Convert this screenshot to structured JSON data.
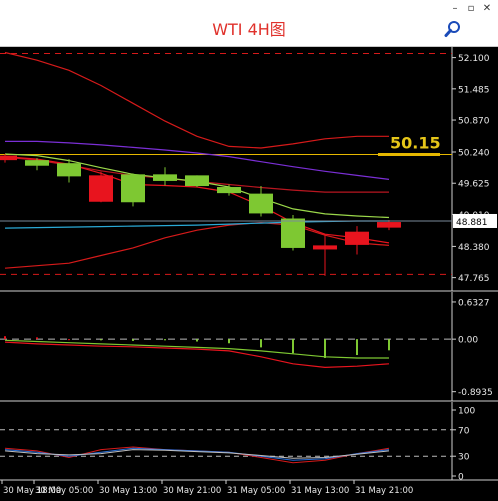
{
  "window": {
    "title": "WTI 4H图",
    "controls": [
      "–",
      "▫",
      "✕"
    ],
    "search_icon": "magnifier-icon"
  },
  "colors": {
    "background": "#000000",
    "bull_candle": "#7ec832",
    "bear_candle": "#e8141e",
    "bb_upper": "#d61a1a",
    "bb_lower": "#d61a1a",
    "bb_middle": "#e8141e",
    "ma_purple": "#7b2fd6",
    "ma_green": "#9bd84a",
    "ma_cyan": "#2aa9d6",
    "level_line": "#e6b800",
    "price_tag_text": "#e6c619"
  },
  "chart_data": [
    {
      "type": "candlestick",
      "name": "main",
      "y_ticks": [
        "52.100",
        "51.485",
        "50.870",
        "50.240",
        "49.625",
        "49.010",
        "48.380",
        "47.765"
      ],
      "ylim": [
        47.6,
        52.25
      ],
      "current_price": "48.881",
      "annotation": "50.15",
      "level_price": 50.19,
      "dashed_levels": [
        52.18,
        47.83
      ],
      "candles": [
        {
          "o": 50.17,
          "h": 50.2,
          "l": 50.03,
          "c": 50.08
        },
        {
          "o": 49.97,
          "h": 50.12,
          "l": 49.88,
          "c": 50.08
        },
        {
          "o": 49.76,
          "h": 50.1,
          "l": 49.64,
          "c": 50.02
        },
        {
          "o": 49.78,
          "h": 49.85,
          "l": 49.25,
          "c": 49.26
        },
        {
          "o": 49.25,
          "h": 49.82,
          "l": 49.17,
          "c": 49.8
        },
        {
          "o": 49.67,
          "h": 49.94,
          "l": 49.58,
          "c": 49.8
        },
        {
          "o": 49.57,
          "h": 49.78,
          "l": 49.55,
          "c": 49.78
        },
        {
          "o": 49.43,
          "h": 49.6,
          "l": 49.38,
          "c": 49.55
        },
        {
          "o": 49.03,
          "h": 49.57,
          "l": 48.97,
          "c": 49.42
        },
        {
          "o": 48.35,
          "h": 49.0,
          "l": 48.3,
          "c": 48.93
        },
        {
          "o": 48.4,
          "h": 48.6,
          "l": 47.8,
          "c": 48.32
        },
        {
          "o": 48.67,
          "h": 48.78,
          "l": 48.22,
          "c": 48.41
        },
        {
          "o": 48.86,
          "h": 48.9,
          "l": 48.7,
          "c": 48.75
        }
      ],
      "lines": {
        "bb_upper": [
          52.2,
          52.05,
          51.85,
          51.55,
          51.2,
          50.85,
          50.55,
          50.35,
          50.32,
          50.4,
          50.5,
          50.55,
          50.55
        ],
        "bb_middle": [
          50.14,
          50.08,
          49.98,
          49.87,
          49.78,
          49.72,
          49.66,
          49.6,
          49.54,
          49.49,
          49.45,
          49.45,
          49.45
        ],
        "bb_lower": [
          47.95,
          48.0,
          48.05,
          48.2,
          48.35,
          48.55,
          48.7,
          48.8,
          48.85,
          48.8,
          48.6,
          48.45,
          48.4
        ],
        "ma_purple": [
          50.45,
          50.45,
          50.42,
          50.38,
          50.33,
          50.28,
          50.22,
          50.15,
          50.05,
          49.95,
          49.86,
          49.78,
          49.7
        ],
        "ma_green": [
          50.2,
          50.17,
          50.07,
          49.93,
          49.8,
          49.73,
          49.66,
          49.55,
          49.33,
          49.12,
          49.02,
          48.98,
          48.95
        ],
        "ma_cyan": [
          48.74,
          48.75,
          48.76,
          48.77,
          48.78,
          48.79,
          48.8,
          48.82,
          48.84,
          48.86,
          48.87,
          48.88,
          48.88
        ],
        "ma_red": [
          50.15,
          50.1,
          50.0,
          49.82,
          49.6,
          49.58,
          49.55,
          49.45,
          49.18,
          48.85,
          48.62,
          48.55,
          48.45
        ]
      }
    },
    {
      "type": "bar",
      "name": "macd",
      "y_ticks": [
        "0.6327",
        "0.00",
        "-0.8935"
      ],
      "ylim": [
        -0.95,
        0.7
      ],
      "histogram": [
        0.05,
        0.03,
        0.0,
        -0.02,
        -0.03,
        -0.02,
        -0.04,
        -0.07,
        -0.14,
        -0.24,
        -0.32,
        -0.27,
        -0.19
      ],
      "signal": [
        -0.02,
        -0.04,
        -0.06,
        -0.08,
        -0.1,
        -0.12,
        -0.14,
        -0.16,
        -0.2,
        -0.25,
        -0.3,
        -0.32,
        -0.32
      ],
      "macd_line": [
        -0.05,
        -0.08,
        -0.1,
        -0.12,
        -0.13,
        -0.15,
        -0.17,
        -0.2,
        -0.3,
        -0.42,
        -0.48,
        -0.46,
        -0.42
      ]
    },
    {
      "type": "line",
      "name": "stochastic",
      "y_ticks": [
        "100",
        "70",
        "30",
        "0"
      ],
      "ylim": [
        0,
        100
      ],
      "levels": [
        70,
        30
      ],
      "series": [
        {
          "values": [
            42,
            38,
            28,
            40,
            44,
            40,
            38,
            36,
            28,
            20,
            24,
            34,
            42
          ]
        },
        {
          "values": [
            40,
            36,
            30,
            36,
            42,
            40,
            38,
            36,
            30,
            24,
            26,
            34,
            40
          ]
        },
        {
          "values": [
            38,
            34,
            32,
            34,
            40,
            39,
            37,
            35,
            31,
            27,
            28,
            33,
            38
          ]
        }
      ]
    }
  ],
  "x_axis": {
    "tick_labels": [
      "30 May 18:00",
      "30 May 05:00",
      "30 May 13:00",
      "30 May 21:00",
      "31 May 05:00",
      "31 May 13:00",
      "31 May 21:00"
    ]
  }
}
